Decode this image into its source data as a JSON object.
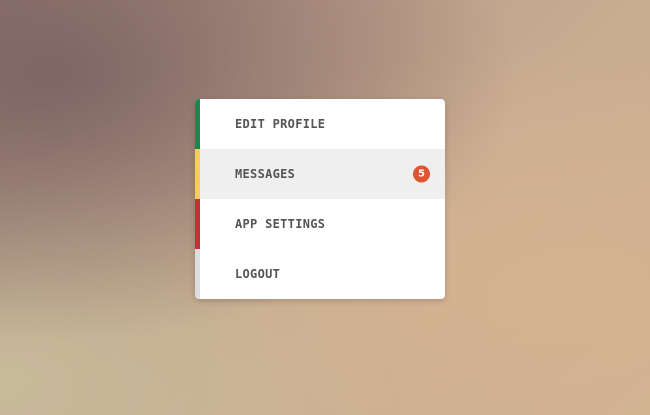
{
  "menu": {
    "items": [
      {
        "label": "EDIT PROFILE",
        "accent_color": "#158a4e",
        "active": false
      },
      {
        "label": "MESSAGES",
        "accent_color": "#f4cd5c",
        "active": true,
        "badge": "5"
      },
      {
        "label": "APP SETTINGS",
        "accent_color": "#cc2d35",
        "active": false
      },
      {
        "label": "LOGOUT",
        "accent_color": "#dddddd",
        "active": false
      }
    ],
    "badge_color": "#dd5533"
  }
}
